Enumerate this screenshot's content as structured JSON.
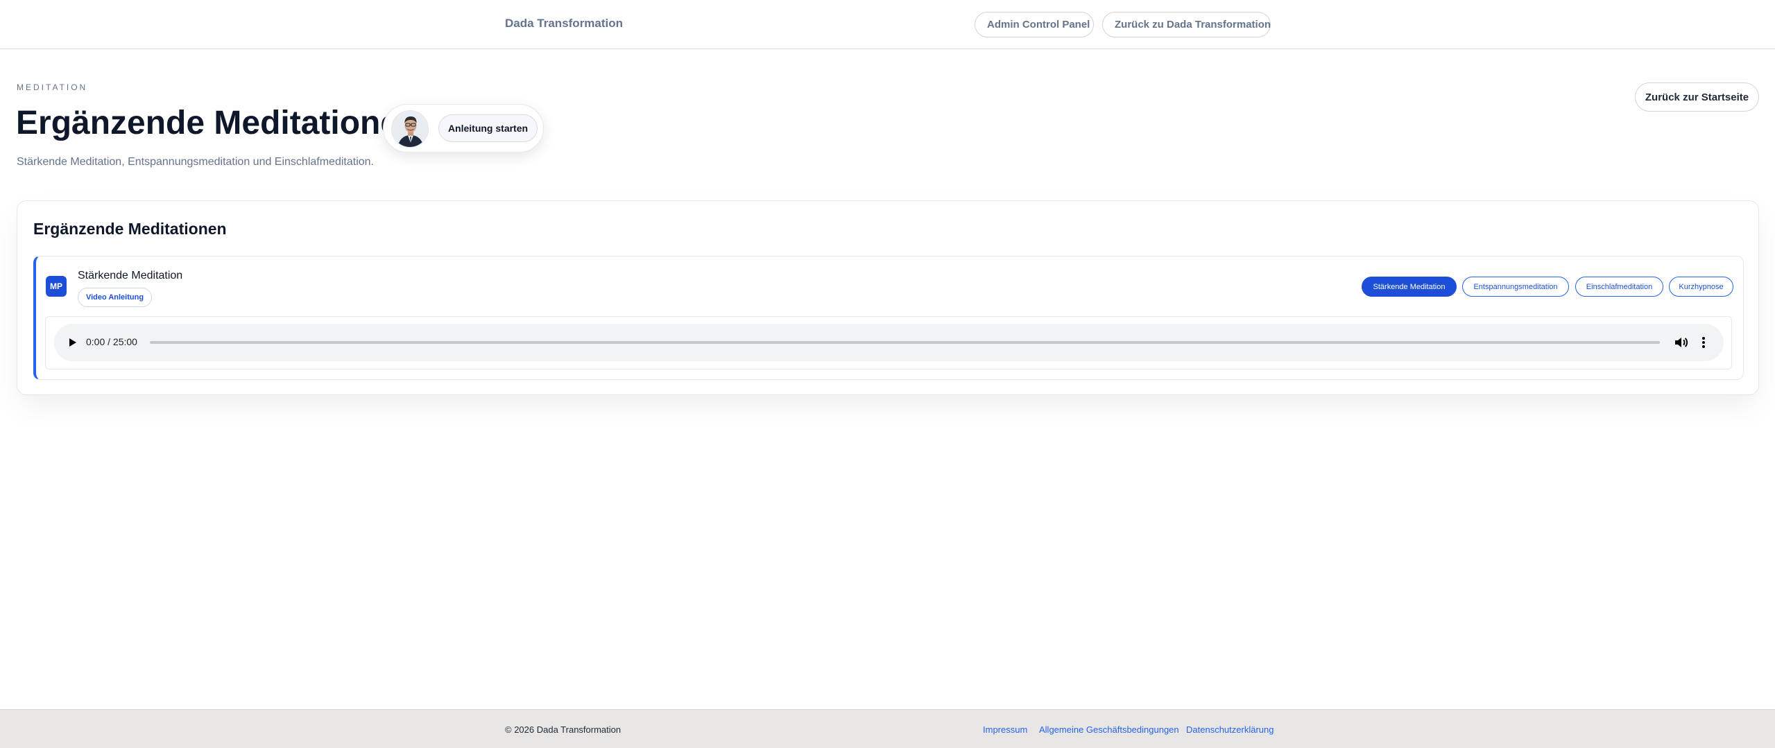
{
  "header": {
    "brand": "Dada Transformation",
    "nav": {
      "admin_label": "Admin Control Panel",
      "back_label": "Zurück zu Dada Transformation"
    }
  },
  "page": {
    "eyebrow": "MEDITATION",
    "title": "Ergänzende Meditationen",
    "guide_button": "Anleitung starten",
    "subtitle": "Stärkende Meditation, Entspannungsmeditation und Einschlafmeditation.",
    "home_button": "Zurück zur Startseite"
  },
  "card": {
    "title": "Ergänzende Meditationen",
    "track": {
      "badge": "MP",
      "title": "Stärkende Meditation",
      "tag": "Video Anleitung",
      "tabs": [
        {
          "label": "Stärkende Meditation",
          "active": true
        },
        {
          "label": "Entspannungsmeditation",
          "active": false
        },
        {
          "label": "Einschlafmeditation",
          "active": false
        },
        {
          "label": "Kurzhypnose",
          "active": false
        }
      ],
      "player": {
        "time": "0:00 / 25:00",
        "progress_fraction": 0.0
      }
    }
  },
  "footer": {
    "copyright": "© 2026 Dada Transformation",
    "links": [
      "Impressum",
      "Allgemeine Geschäftsbedingungen",
      "Datenschutzerklärung"
    ]
  },
  "colors": {
    "accent": "#1d4ed8",
    "track_border": "#2563eb",
    "footer_bg": "#e7e6e5"
  }
}
